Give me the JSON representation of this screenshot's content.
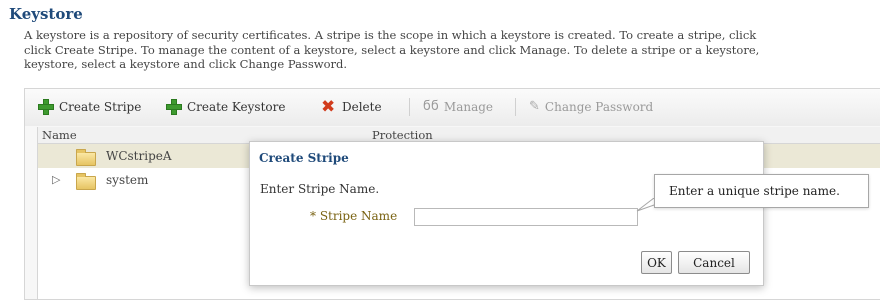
{
  "page": {
    "title": "Keystore",
    "description_lines": [
      "A keystore is a repository of security certificates. A stripe is the scope in which a keystore is created. To create a stripe, click",
      "click Create Stripe. To manage the content of a keystore, select a keystore and click Manage. To delete a stripe or a keystore,",
      "keystore, select a keystore and click Change Password."
    ]
  },
  "toolbar": {
    "create_stripe": "Create Stripe",
    "create_keystore": "Create Keystore",
    "delete": "Delete",
    "manage": "Manage",
    "change_password": "Change Password"
  },
  "table": {
    "columns": [
      "Name",
      "Protection"
    ],
    "rows": [
      {
        "name": "WCstripeA",
        "expandable": false,
        "selected": true
      },
      {
        "name": "system",
        "expandable": true,
        "selected": false
      }
    ]
  },
  "dialog": {
    "title": "Create Stripe",
    "instruction": "Enter Stripe Name.",
    "field_label": "* Stripe Name",
    "field_value": "",
    "ok_label": "OK",
    "cancel_label": "Cancel"
  },
  "tooltip": {
    "text": "Enter a unique stripe name."
  },
  "colors": {
    "title": "#1f4a7a",
    "selected_row": "#ebe8d6",
    "required_label": "#7a6313"
  }
}
